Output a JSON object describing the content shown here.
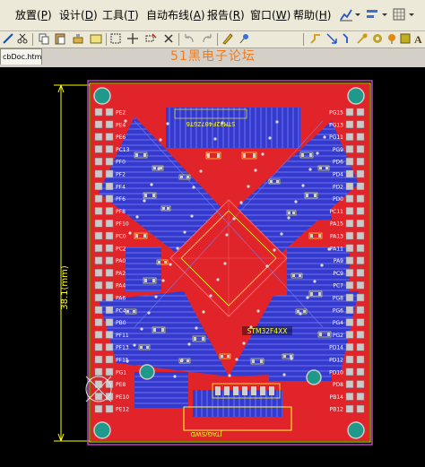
{
  "menu": {
    "items": [
      "放置(P)",
      "设计(D)",
      "工具(T)",
      "自动布线(A)",
      "报告(R)",
      "窗口(W)",
      "帮助(H)"
    ],
    "item_labels": [
      "放置",
      "设计",
      "工具",
      "自动布线",
      "报告",
      "窗口",
      "帮助"
    ],
    "item_hotkeys": [
      "P",
      "D",
      "T",
      "A",
      "R",
      "W",
      "H"
    ]
  },
  "tabs": {
    "document": "cbDoc.htm"
  },
  "watermark": "51黑电子论坛",
  "board": {
    "chip_label": "STM32F4XX",
    "mirrored_label_top": "STM32F407ZGT6",
    "mirrored_label_bottom": "JTAG/SWD",
    "dimension_label": "38.1(mm)",
    "dimension_label_rendered": "38.1(mm)",
    "right_header_pins": [
      "PG15",
      "PG13",
      "PG11",
      "PG9",
      "PD6",
      "PD4",
      "PD2",
      "PD0",
      "PC11",
      "PA15",
      "PA13",
      "PA11",
      "PA9",
      "PC9",
      "PC7",
      "PG8",
      "PG6",
      "PG4",
      "PG2",
      "PD14",
      "PD12",
      "PD10",
      "PD8",
      "PB14",
      "PB12"
    ],
    "left_header_pins": [
      "PE2",
      "PE4",
      "PE6",
      "PC13",
      "PF0",
      "PF2",
      "PF4",
      "PF6",
      "PF8",
      "PF10",
      "PC0",
      "PC2",
      "PA0",
      "PA2",
      "PA4",
      "PA6",
      "PC4",
      "PB0",
      "PF11",
      "PF13",
      "PF15",
      "PG1",
      "PE8",
      "PE10",
      "PE12"
    ],
    "colors": {
      "background": "#000000",
      "top_copper": "#e0242a",
      "bottom_copper": "#2a3cd6",
      "pad": "#c9c9c9",
      "via": "#d9d9d9",
      "silkscreen": "#ffff33",
      "outline": "#ffff00",
      "keepout": "#c040c0",
      "mount_hole": "#1f9a8a"
    }
  },
  "toolbar": {
    "icons": [
      "unlink-icon",
      "cut-icon",
      "copy-icon",
      "paste-icon",
      "rubber-stamp-icon",
      "select-rect-icon",
      "move-icon",
      "deselect-icon",
      "cross-icon",
      "undo-icon",
      "redo-icon",
      "highlighter-icon",
      "pin-icon",
      "arrow-icon",
      "route-icon",
      "via-icon",
      "pad-icon",
      "polygon-icon",
      "fill-icon",
      "arc-icon",
      "string-icon"
    ]
  }
}
